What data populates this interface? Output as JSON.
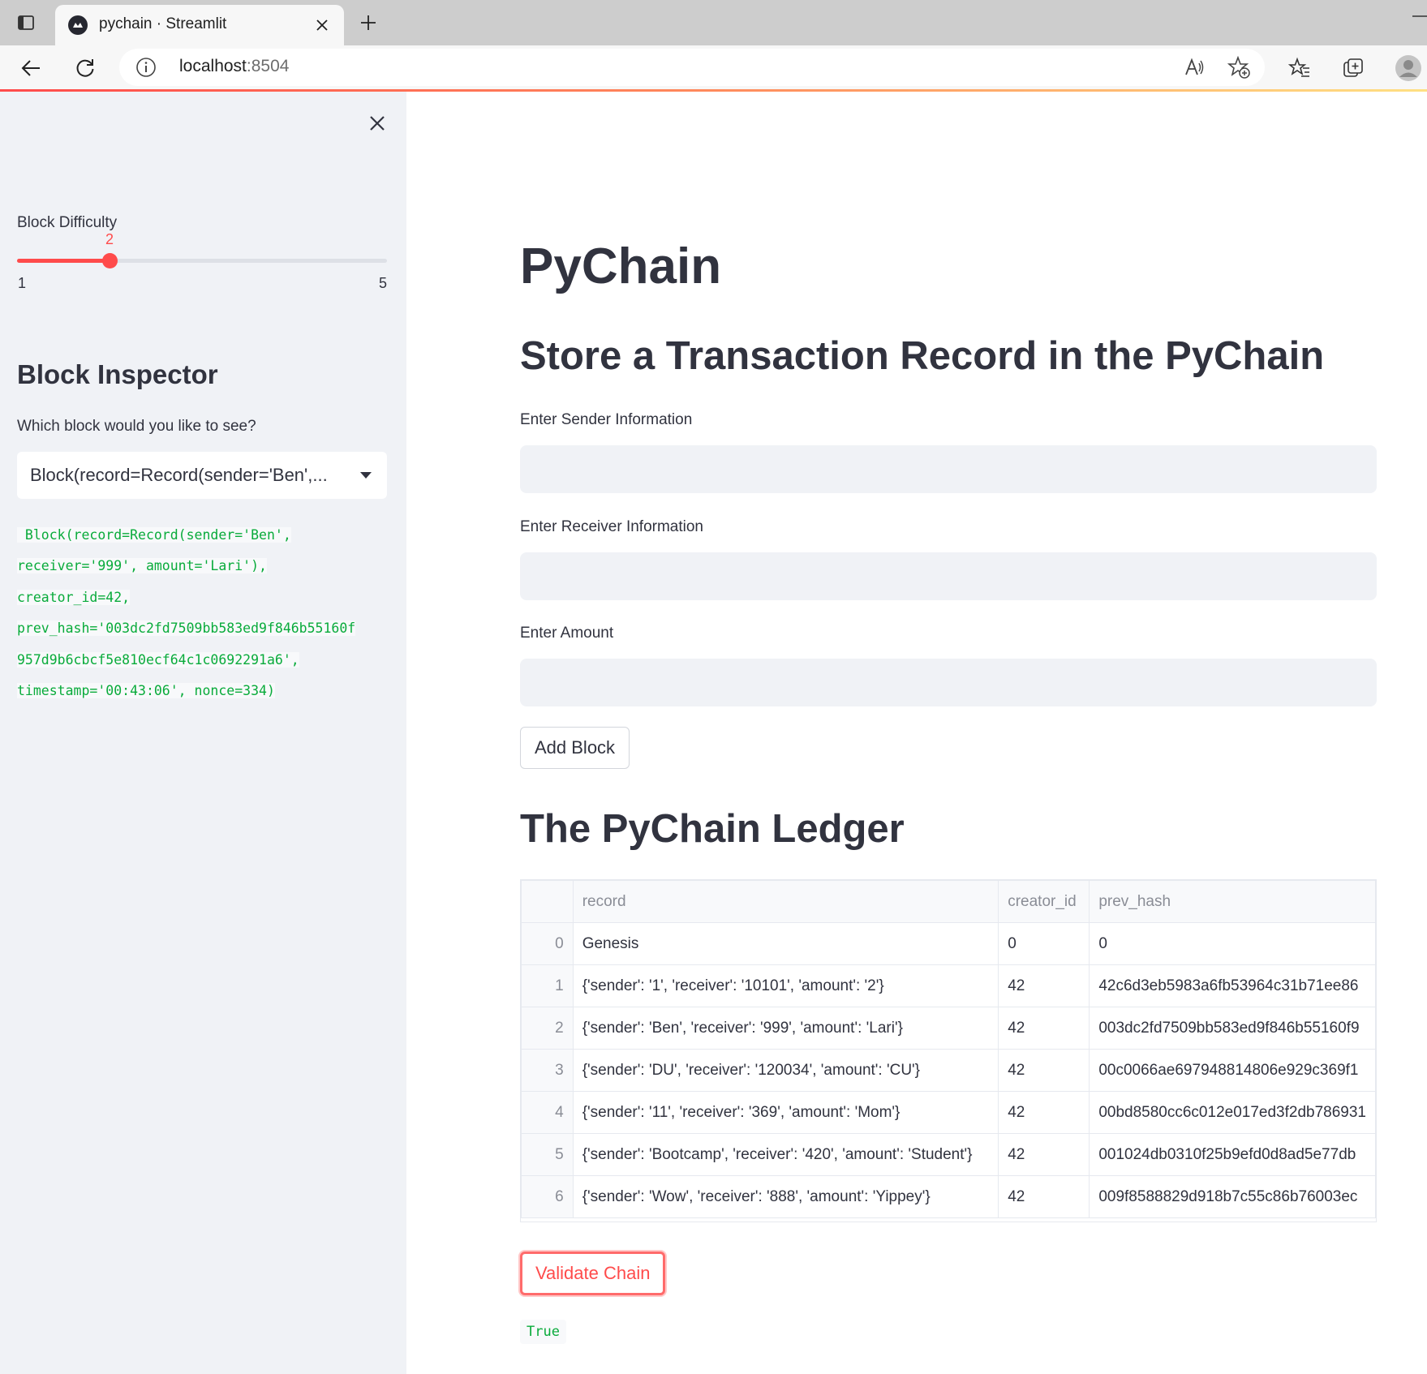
{
  "browser": {
    "tab_title": "pychain · Streamlit",
    "url_host": "localhost",
    "url_port": ":8504"
  },
  "sidebar": {
    "difficulty": {
      "label": "Block Difficulty",
      "value": "2",
      "min": "1",
      "max": "5",
      "fraction": 0.25
    },
    "inspector_heading": "Block Inspector",
    "select_label": "Which block would you like to see?",
    "select_value": "Block(record=Record(sender='Ben',...",
    "block_code_lines": [
      " Block(record=Record(sender='Ben',",
      "receiver='999', amount='Lari'),",
      "creator_id=42,",
      "prev_hash='003dc2fd7509bb583ed9f846b55160f",
      "957d9b6cbcf5e810ecf64c1c0692291a6',",
      "timestamp='00:43:06', nonce=334)"
    ]
  },
  "main": {
    "title": "PyChain",
    "subtitle": "Store a Transaction Record in the PyChain",
    "sender_label": "Enter Sender Information",
    "receiver_label": "Enter Receiver Information",
    "amount_label": "Enter Amount",
    "add_block_label": "Add Block",
    "ledger_heading": "The PyChain Ledger",
    "ledger": {
      "columns": [
        "",
        "record",
        "creator_id",
        "prev_hash"
      ],
      "rows": [
        [
          "0",
          "Genesis",
          "0",
          "0"
        ],
        [
          "1",
          "{'sender': '1', 'receiver': '10101', 'amount': '2'}",
          "42",
          "42c6d3eb5983a6fb53964c31b71ee86"
        ],
        [
          "2",
          "{'sender': 'Ben', 'receiver': '999', 'amount': 'Lari'}",
          "42",
          "003dc2fd7509bb583ed9f846b55160f9"
        ],
        [
          "3",
          "{'sender': 'DU', 'receiver': '120034', 'amount': 'CU'}",
          "42",
          "00c0066ae697948814806e929c369f1"
        ],
        [
          "4",
          "{'sender': '11', 'receiver': '369', 'amount': 'Mom'}",
          "42",
          "00bd8580cc6c012e017ed3f2db786931"
        ],
        [
          "5",
          "{'sender': 'Bootcamp', 'receiver': '420', 'amount': 'Student'}",
          "42",
          "001024db0310f25b9efd0d8ad5e77db"
        ],
        [
          "6",
          "{'sender': 'Wow', 'receiver': '888', 'amount': 'Yippey'}",
          "42",
          "009f8588829d918b7c55c86b76003ec"
        ]
      ]
    },
    "validate_label": "Validate Chain",
    "validate_result": "True"
  },
  "colors": {
    "accent": "#ff4b4b",
    "sidebar_bg": "#f0f2f6",
    "code_green": "#09ab3b",
    "text": "#31333f"
  }
}
